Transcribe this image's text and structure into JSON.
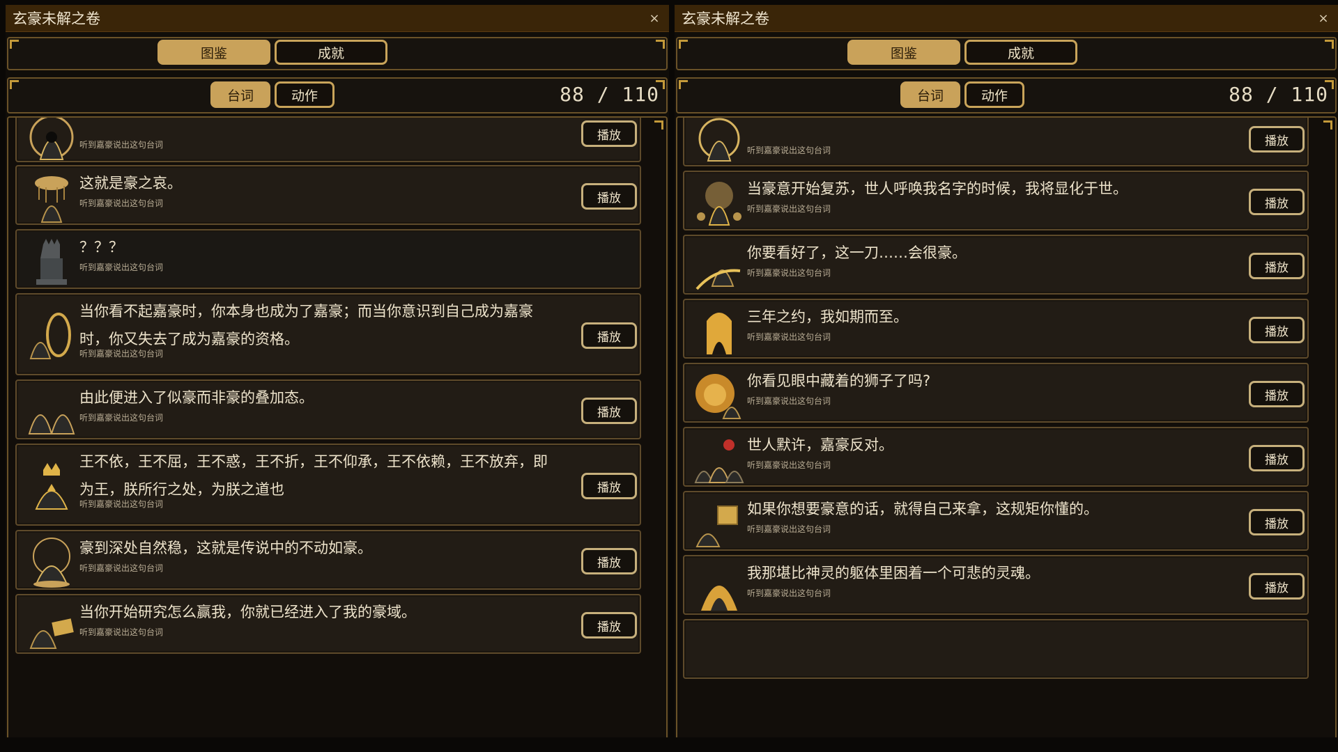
{
  "colors": {
    "accent": "#c9a25a",
    "panel_bg": "#100d09",
    "card_bg": "#221c15",
    "titlebar": "#3a2508"
  },
  "left": {
    "title": "玄豪未解之卷",
    "close": "×",
    "tabs": {
      "main_1": "图鉴",
      "main_2": "成就",
      "sub_1": "台词",
      "sub_2": "动作"
    },
    "count": "88 / 110",
    "cards": [
      {
        "quote": "",
        "condition": "听到嘉豪说出这句台词",
        "play": "播放",
        "icon": "hooded-figure-gold-aura-icon"
      },
      {
        "quote": "这就是豪之哀。",
        "condition": "听到嘉豪说出这句台词",
        "play": "播放",
        "icon": "hooded-figure-rain-cloud-icon"
      },
      {
        "quote": "？？？",
        "condition": "听到嘉豪说出这句台词",
        "play": "",
        "icon": "throne-locked-icon"
      },
      {
        "quote": "当你看不起嘉豪时，你本身也成为了嘉豪；而当你意识到自己成为嘉豪时，你又失去了成为嘉豪的资格。",
        "condition": "听到嘉豪说出这句台词",
        "play": "播放",
        "icon": "hooded-figure-mirror-icon"
      },
      {
        "quote": "由此便进入了似豪而非豪的叠加态。",
        "condition": "听到嘉豪说出这句台词",
        "play": "播放",
        "icon": "twin-hooded-figures-icon"
      },
      {
        "quote": "王不依，王不屈，王不惑，王不折，王不仰承，王不依赖，王不放弃，即为王，朕所行之处，为朕之道也",
        "condition": "听到嘉豪说出这句台词",
        "play": "播放",
        "icon": "crowned-king-icon"
      },
      {
        "quote": "豪到深处自然稳，这就是传说中的不动如豪。",
        "condition": "听到嘉豪说出这句台词",
        "play": "播放",
        "icon": "meditating-figure-icon"
      },
      {
        "quote": "当你开始研究怎么赢我，你就已经进入了我的豪域。",
        "condition": "听到嘉豪说出这句台词",
        "play": "播放",
        "icon": "hooded-figure-card-icon"
      }
    ]
  },
  "right": {
    "title": "玄豪未解之卷",
    "close": "×",
    "tabs": {
      "main_1": "图鉴",
      "main_2": "成就",
      "sub_1": "台词",
      "sub_2": "动作"
    },
    "count": "88 / 110",
    "cards": [
      {
        "quote": "",
        "condition": "听到嘉豪说出这句台词",
        "play": "播放",
        "icon": "hooded-figure-gold-aura-icon"
      },
      {
        "quote": "当豪意开始复苏，世人呼唤我名字的时候，我将显化于世。",
        "condition": "听到嘉豪说出这句台词",
        "play": "播放",
        "icon": "radiant-figure-crowd-icon"
      },
      {
        "quote": "你要看好了，这一刀……会很豪。",
        "condition": "听到嘉豪说出这句台词",
        "play": "播放",
        "icon": "sword-slash-figure-icon"
      },
      {
        "quote": "三年之约，我如期而至。",
        "condition": "听到嘉豪说出这句台词",
        "play": "播放",
        "icon": "glowing-doorway-icon"
      },
      {
        "quote": "你看见眼中藏着的狮子了吗?",
        "condition": "听到嘉豪说出这句台词",
        "play": "播放",
        "icon": "lion-figure-icon"
      },
      {
        "quote": "世人默许，嘉豪反对。",
        "condition": "听到嘉豪说出这句台词",
        "play": "播放",
        "icon": "crowd-reject-icon"
      },
      {
        "quote": "如果你想要豪意的话，就得自己来拿，这规矩你懂的。",
        "condition": "听到嘉豪说出这句台词",
        "play": "播放",
        "icon": "figure-holding-box-icon"
      },
      {
        "quote": "我那堪比神灵的躯体里困着一个可悲的灵魂。",
        "condition": "听到嘉豪说出这句台词",
        "play": "播放",
        "icon": "golden-deity-icon"
      }
    ]
  }
}
